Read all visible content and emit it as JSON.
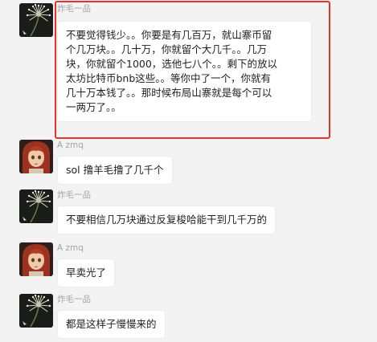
{
  "messages": [
    {
      "sender": "炸毛一品",
      "avatar": "dandelion-avatar",
      "lines": [
        "不要觉得钱少。。你要是有几百万，就山寨币留",
        "个几万块。。几十万，你就留个大几千。。几万",
        "块，你就留个1000，选他七八个。。剩下的放以",
        "太坊比特币bnb这些。。等你中了一个，你就有",
        "几十万本钱了。。那时候布局山寨就是每个可以",
        "一两万了。。"
      ]
    },
    {
      "sender": "A zmq",
      "avatar": "anime-girl-avatar",
      "lines": [
        "sol 撸羊毛撸了几千个"
      ]
    },
    {
      "sender": "炸毛一品",
      "avatar": "dandelion-avatar",
      "lines": [
        "不要相信几万块通过反复梭哈能干到几千万的"
      ]
    },
    {
      "sender": "A zmq",
      "avatar": "anime-girl-avatar",
      "lines": [
        "早卖光了"
      ]
    },
    {
      "sender": "炸毛一品",
      "avatar": "dandelion-avatar",
      "lines": [
        "都是这样子慢慢来的"
      ]
    }
  ],
  "colors": {
    "background": "#f3f3f3",
    "bubble": "#ffffff",
    "highlight_border": "#e5322d",
    "sender_name": "#a3a3a3"
  }
}
